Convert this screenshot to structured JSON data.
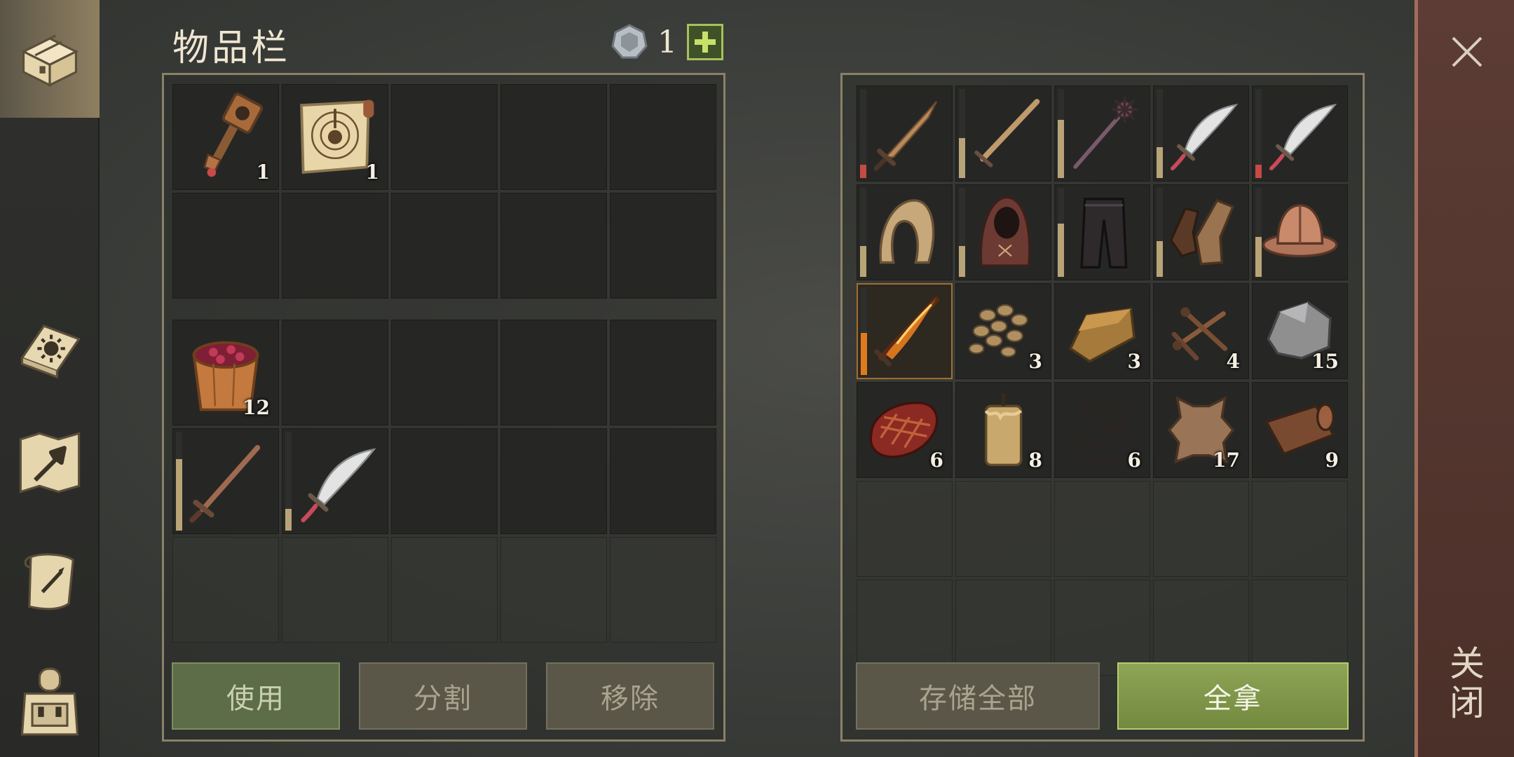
{
  "header": {
    "title": "物品栏",
    "currency_count": "1"
  },
  "sidebar": {
    "tabs": [
      {
        "name": "chest-icon"
      },
      {
        "name": "recipe-book-icon"
      },
      {
        "name": "crafting-map-icon"
      },
      {
        "name": "quest-scroll-icon"
      },
      {
        "name": "character-backpack-icon"
      }
    ]
  },
  "inventory": {
    "top": [
      {
        "item": "key-icon",
        "qty": "1"
      },
      {
        "item": "ritual-scroll-icon",
        "qty": "1"
      }
    ],
    "bottom": [
      {
        "item": "berry-bucket-icon",
        "qty": "12"
      },
      {
        "item": "sword-icon",
        "qty": "",
        "durability": 0.72
      },
      {
        "item": "scimitar-icon",
        "qty": "",
        "durability": 0.22
      }
    ]
  },
  "container": {
    "rows": [
      [
        {
          "item": "bronze-sword-icon",
          "durability": 0.15,
          "dur_color": "red"
        },
        {
          "item": "long-sword-icon",
          "durability": 0.45
        },
        {
          "item": "spiked-mace-icon",
          "durability": 0.65
        },
        {
          "item": "scimitar-icon",
          "durability": 0.35
        },
        {
          "item": "scimitar-icon",
          "durability": 0.15,
          "dur_color": "red"
        }
      ],
      [
        {
          "item": "cloth-hood-icon",
          "durability": 0.35
        },
        {
          "item": "cloak-hood-icon",
          "durability": 0.35
        },
        {
          "item": "leather-pants-icon",
          "durability": 0.6
        },
        {
          "item": "leather-gloves-icon",
          "durability": 0.4
        },
        {
          "item": "kettle-helmet-icon",
          "durability": 0.45
        }
      ],
      [
        {
          "item": "flaming-sword-icon",
          "durability": 0.48,
          "dur_color": "orange"
        },
        {
          "item": "pebbles-icon",
          "qty": "3"
        },
        {
          "item": "metal-ingot-icon",
          "qty": "3"
        },
        {
          "item": "nails-icon",
          "qty": "4"
        },
        {
          "item": "stone-icon",
          "qty": "15"
        }
      ],
      [
        {
          "item": "raw-meat-icon",
          "qty": "6"
        },
        {
          "item": "candle-icon",
          "qty": "8"
        },
        {
          "item": "rope-icon",
          "qty": "6"
        },
        {
          "item": "animal-hide-icon",
          "qty": "17"
        },
        {
          "item": "leather-roll-icon",
          "qty": "9"
        }
      ]
    ]
  },
  "buttons": {
    "use": "使用",
    "split": "分割",
    "remove": "移除",
    "store_all": "存储全部",
    "take_all": "全拿",
    "close": "关闭"
  },
  "colors": {
    "accent_green": "#8ea556",
    "panel_border": "#8a8268",
    "close_bar": "#5c3c34"
  }
}
